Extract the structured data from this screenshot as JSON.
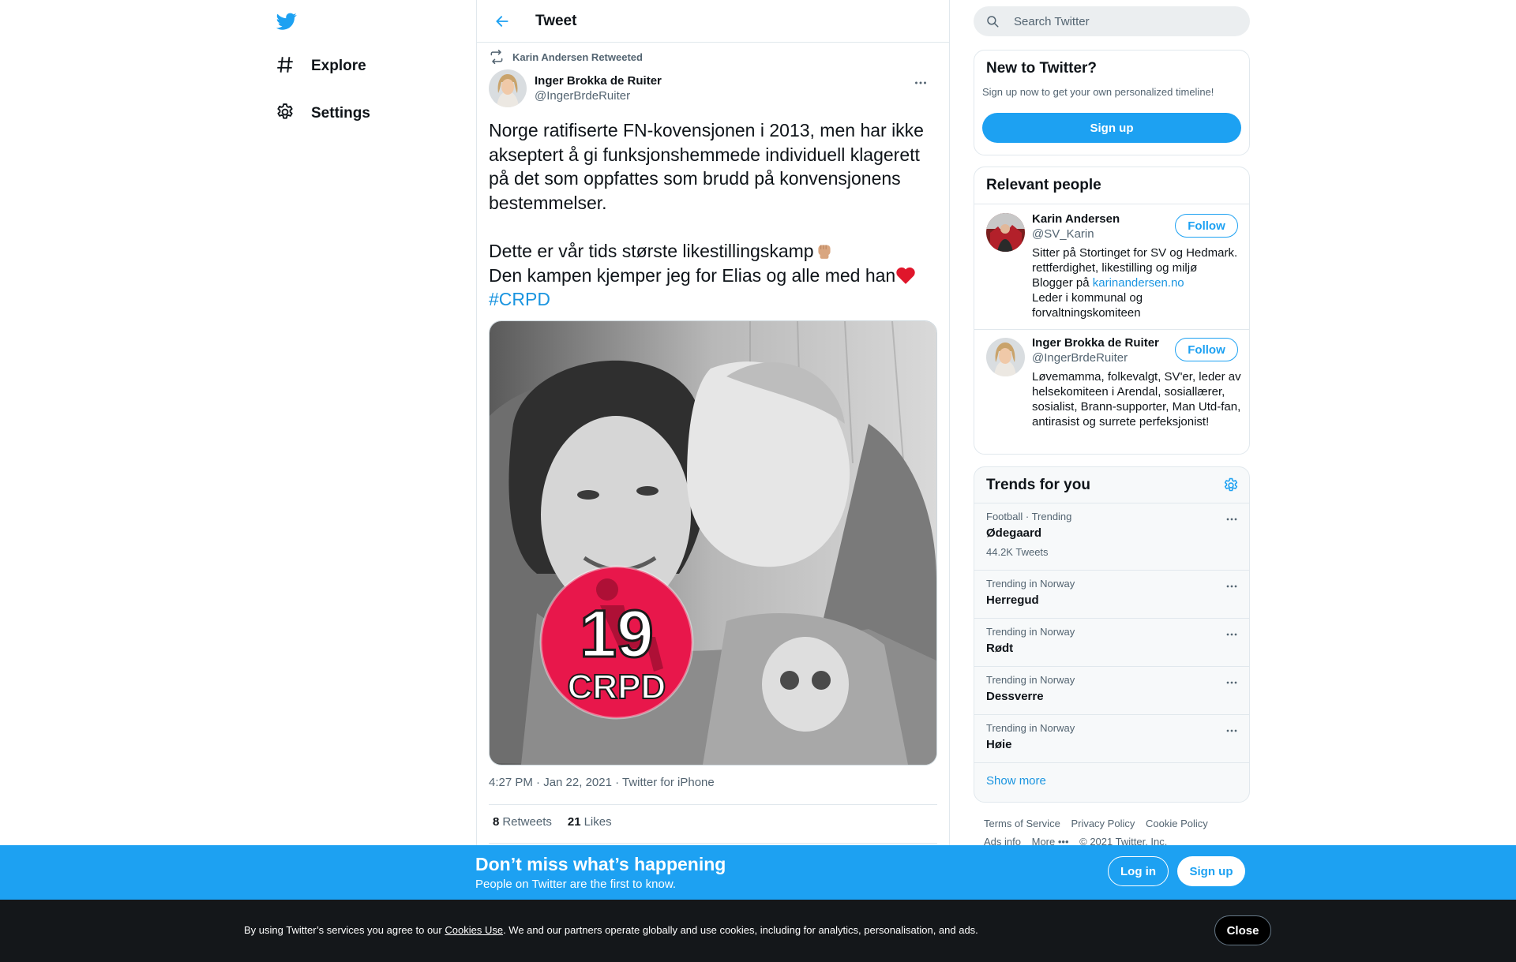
{
  "nav": {
    "logo_icon": "twitter-bird-icon",
    "items": [
      {
        "label": "Explore",
        "icon": "hashtag-icon"
      },
      {
        "label": "Settings",
        "icon": "gear-icon"
      }
    ]
  },
  "header": {
    "title": "Tweet",
    "back_icon": "arrow-left-icon"
  },
  "tweet": {
    "retweeted_by": "Karin Andersen Retweeted",
    "author_name": "Inger Brokka de Ruiter",
    "author_handle": "@IngerBrdeRuiter",
    "text_para1": "Norge ratifiserte FN-kovensjonen i 2013, men har ikke akseptert å gi funksjonshemmede individuell klagerett på det som oppfattes som brudd på konvensjonens bestemmelser.",
    "text_line2": "Dette er vår tids største likestillingskamp",
    "text_line3": "Den kampen kjemper jeg for Elias og alle med han",
    "hashtag": "#CRPD",
    "media_badge_number": "19",
    "media_badge_text": "CRPD",
    "timestamp": "4:27 PM · Jan 22, 2021",
    "source": "Twitter for iPhone",
    "retweets_count": "8",
    "retweets_label": "Retweets",
    "likes_count": "21",
    "likes_label": "Likes"
  },
  "search": {
    "placeholder": "Search Twitter"
  },
  "new_to_twitter": {
    "title": "New to Twitter?",
    "subtitle": "Sign up now to get your own personalized timeline!",
    "button": "Sign up"
  },
  "relevant_people": {
    "title": "Relevant people",
    "people": [
      {
        "name": "Karin Andersen",
        "handle": "@SV_Karin",
        "bio_before_link": "Sitter på Stortinget for SV og Hedmark. rettferdighet, likestilling og miljø Blogger på ",
        "bio_link": "karinandersen.no",
        "bio_after_link": "Leder i kommunal og forvaltningskomiteen",
        "follow": "Follow"
      },
      {
        "name": "Inger Brokka de Ruiter",
        "handle": "@IngerBrdeRuiter",
        "bio": "Løvemamma, folkevalgt, SV'er, leder av helsekomiteen i Arendal, sosiallærer, sosialist, Brann-supporter, Man Utd-fan, antirasist og surrete perfeksjonist!",
        "follow": "Follow"
      }
    ]
  },
  "trends": {
    "title": "Trends for you",
    "items": [
      {
        "context": "Football · Trending",
        "name": "Ødegaard",
        "count": "44.2K Tweets"
      },
      {
        "context": "Trending in Norway",
        "name": "Herregud"
      },
      {
        "context": "Trending in Norway",
        "name": "Rødt"
      },
      {
        "context": "Trending in Norway",
        "name": "Dessverre"
      },
      {
        "context": "Trending in Norway",
        "name": "Høie"
      }
    ],
    "show_more": "Show more"
  },
  "footer": {
    "terms": "Terms of Service",
    "privacy": "Privacy Policy",
    "cookie": "Cookie Policy",
    "ads": "Ads info",
    "more": "More",
    "copyright": "© 2021 Twitter, Inc."
  },
  "banner": {
    "headline": "Don’t miss what’s happening",
    "subline": "People on Twitter are the first to know.",
    "login": "Log in",
    "signup": "Sign up"
  },
  "cookie_bar": {
    "text_before": "By using Twitter’s services you agree to our ",
    "link": "Cookies Use",
    "text_after": ". We and our partners operate globally and use cookies, including for analytics, personalisation, and ads.",
    "close": "Close"
  },
  "colors": {
    "accent": "#1da1f2",
    "link": "#1b95e0",
    "cookie_bg": "#14171a",
    "badge_red": "#e8174b"
  }
}
